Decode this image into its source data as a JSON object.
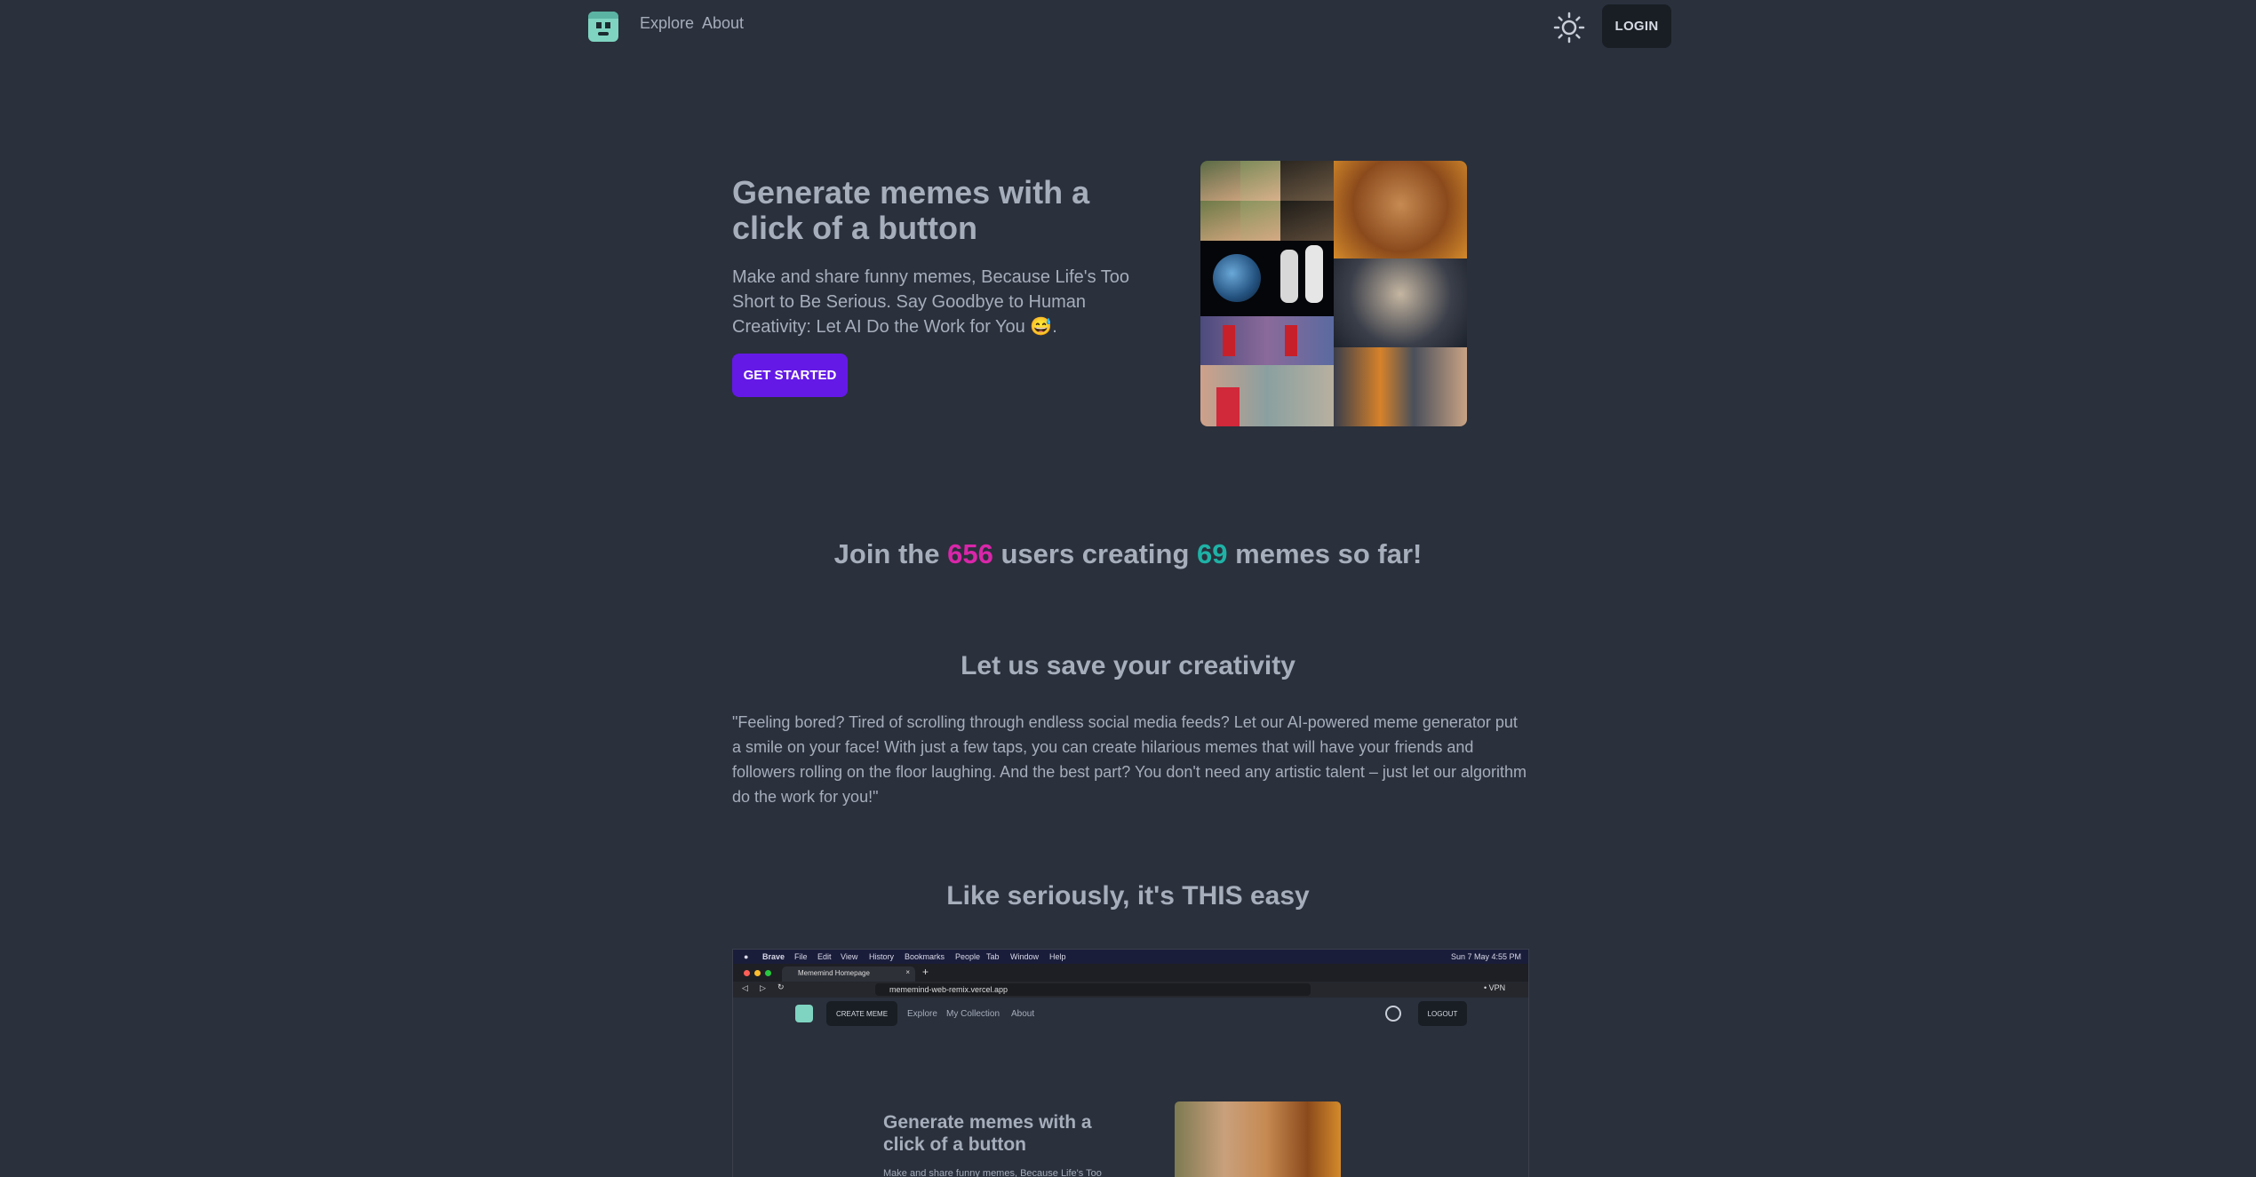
{
  "nav": {
    "links": [
      "Explore",
      "About"
    ],
    "login_label": "LOGIN"
  },
  "hero": {
    "title": "Generate memes with a click of a button",
    "subtitle": "Make and share funny memes, Because Life's Too Short to Be Serious. Say Goodbye to Human Creativity: Let AI Do the Work for You 😅.",
    "cta_label": "GET STARTED"
  },
  "stats": {
    "prefix": "Join the",
    "users": "656",
    "middle": "users creating",
    "memes": "69",
    "suffix": "memes so far!"
  },
  "creativity": {
    "heading": "Let us save your creativity",
    "body": "\"Feeling bored? Tired of scrolling through endless social media feeds? Let our AI-powered meme generator put a smile on your face! With just a few taps, you can create hilarious memes that will have your friends and followers rolling on the floor laughing. And the best part? You don't need any artistic talent – just let our algorithm do the work for you!\""
  },
  "easy": {
    "heading": "Like seriously, it's THIS easy"
  },
  "screenshot": {
    "menubar": [
      "Brave",
      "File",
      "Edit",
      "View",
      "History",
      "Bookmarks",
      "People",
      "Tab",
      "Window",
      "Help"
    ],
    "clock": "Sun 7 May  4:55 PM",
    "tab_title": "Mememind Homepage",
    "url": "mememind-web-remix.vercel.app",
    "vpn": "• VPN",
    "create_label": "CREATE MEME",
    "links": [
      "Explore",
      "My Collection",
      "About"
    ],
    "logout_label": "LOGOUT",
    "hero_title": "Generate memes with a click of a button",
    "hero_sub_partial": "Make and share funny memes, Because Life's Too"
  },
  "colors": {
    "background": "#2a303c",
    "primary": "#6419e6",
    "secondary": "#d926a9",
    "accent": "#1fb2a6"
  },
  "icons": [
    "logo-icon",
    "theme-toggle-sun-icon"
  ]
}
